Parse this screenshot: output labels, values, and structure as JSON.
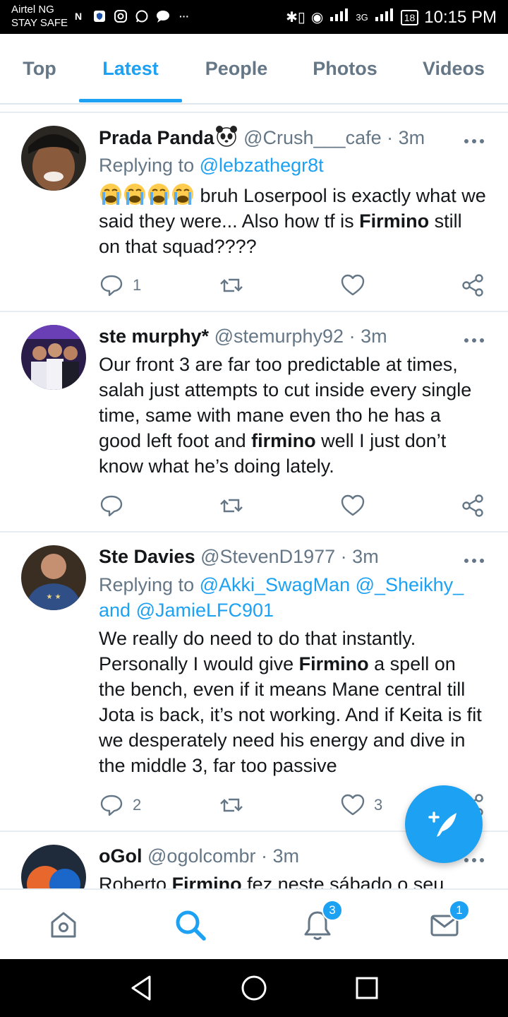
{
  "status_bar": {
    "carrier_line1": "Airtel NG",
    "carrier_line2": "STAY SAFE",
    "network_label": "3G",
    "battery": "18",
    "time": "10:15 PM"
  },
  "tabs": [
    {
      "label": "Top",
      "active": false
    },
    {
      "label": "Latest",
      "active": true
    },
    {
      "label": "People",
      "active": false
    },
    {
      "label": "Photos",
      "active": false
    },
    {
      "label": "Videos",
      "active": false
    }
  ],
  "tweets": [
    {
      "name": "Prada Panda",
      "handle": "@Crush___cafe",
      "sep": "·",
      "time": "3m",
      "replying_prefix": "Replying to ",
      "replying_to": "@lebzathegr8t",
      "body_pre": " bruh Loserpool is exactly what we said they were... Also how tf is ",
      "body_bold": "Firmino",
      "body_post": " still on that squad????",
      "reply_count": "1",
      "retweet_count": "",
      "like_count": ""
    },
    {
      "name": "ste murphy*",
      "handle": "@stemurphy92",
      "sep": "·",
      "time": "3m",
      "body_pre": "Our front 3 are far too predictable at times, salah just attempts to cut inside every single time, same with mane even tho he has a good left foot and ",
      "body_bold": "firmino",
      "body_post": " well I just don’t know what he’s doing lately.",
      "reply_count": "",
      "retweet_count": "",
      "like_count": ""
    },
    {
      "name": "Ste Davies",
      "handle": "@StevenD1977",
      "sep": "·",
      "time": "3m",
      "replying_prefix": "Replying to ",
      "replying_to_1": "@Akki_SwagMan",
      "replying_to_2": "@_Sheikhy_",
      "replying_and": "and",
      "replying_to_3": "@JamieLFC901",
      "body_pre": "We really do need to do that instantly. Personally I would give ",
      "body_bold": "Firmino",
      "body_post": " a spell on the bench, even if it means Mane central till Jota is back, it’s not working. And if Keita is fit we desperately need his energy and dive in the middle 3, far too passive",
      "reply_count": "2",
      "retweet_count": "",
      "like_count": "3"
    },
    {
      "name": "oGol",
      "handle": "@ogolcombr",
      "sep": "·",
      "time": "3m",
      "body_pre": "Roberto ",
      "body_bold": "Firmino",
      "body_post": " fez neste sábado o seu"
    }
  ],
  "bottom_nav": {
    "notifications_badge": "3",
    "messages_badge": "1"
  },
  "colors": {
    "accent": "#1da1f2",
    "text": "#14171a",
    "muted": "#657786",
    "divider": "#e6ecf0"
  },
  "icons": [
    "home-icon",
    "search-icon",
    "bell-icon",
    "mail-icon",
    "reply-icon",
    "retweet-icon",
    "like-icon",
    "share-icon",
    "more-icon",
    "compose-icon",
    "back-icon",
    "home-circle-icon",
    "recents-icon"
  ]
}
